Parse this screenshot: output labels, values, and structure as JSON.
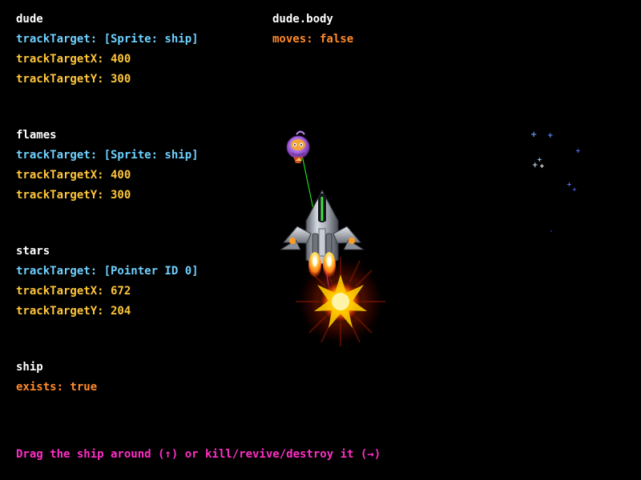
{
  "panels": {
    "dude": {
      "title": "dude",
      "track_target": "trackTarget: [Sprite: ship]",
      "track_target_x": "trackTargetX: 400",
      "track_target_y": "trackTargetY: 300"
    },
    "dude_body": {
      "title": "dude.body",
      "moves": "moves: false"
    },
    "flames": {
      "title": "flames",
      "track_target": "trackTarget: [Sprite: ship]",
      "track_target_x": "trackTargetX: 400",
      "track_target_y": "trackTargetY: 300"
    },
    "stars": {
      "title": "stars",
      "track_target": "trackTarget: [Pointer ID 0]",
      "track_target_x": "trackTargetX: 672",
      "track_target_y": "trackTargetY: 204"
    },
    "ship": {
      "title": "ship",
      "exists": "exists: true"
    }
  },
  "instructions": "Drag the ship around (↑) or kill/revive/destroy it (→)",
  "colors": {
    "background": "#000000",
    "title": "#ffffff",
    "target": "#6fd0ff",
    "coordinate": "#ffc63a",
    "flag": "#ff8a2a",
    "instructions": "#ff2ec7"
  },
  "sprites": {
    "ship": "spaceship",
    "dude": "purple-alien-dude",
    "flames": "engine-flames",
    "explosion": "explosion-burst",
    "stars": "star-particles"
  }
}
